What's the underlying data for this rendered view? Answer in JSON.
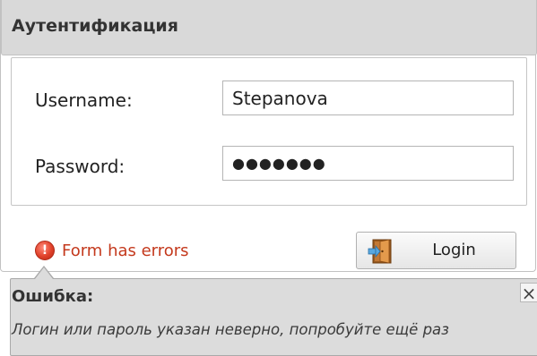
{
  "window": {
    "title": "Аутентификация"
  },
  "form": {
    "username_label": "Username:",
    "username_value": "Stepanova",
    "password_label": "Password:",
    "password_value": "●●●●●●●"
  },
  "status": {
    "error_icon": "!",
    "error_text": "Form has errors"
  },
  "buttons": {
    "login_label": "Login",
    "login_icon": "door-exit-icon"
  },
  "tooltip": {
    "title": "Ошибка:",
    "close_symbol": "×",
    "message": "Логин или пароль указан неверно, попробуйте ещё раз"
  },
  "colors": {
    "error": "#c4391d",
    "title_bar": "#d9d9d9",
    "tooltip_bg": "#dcdcdc"
  }
}
